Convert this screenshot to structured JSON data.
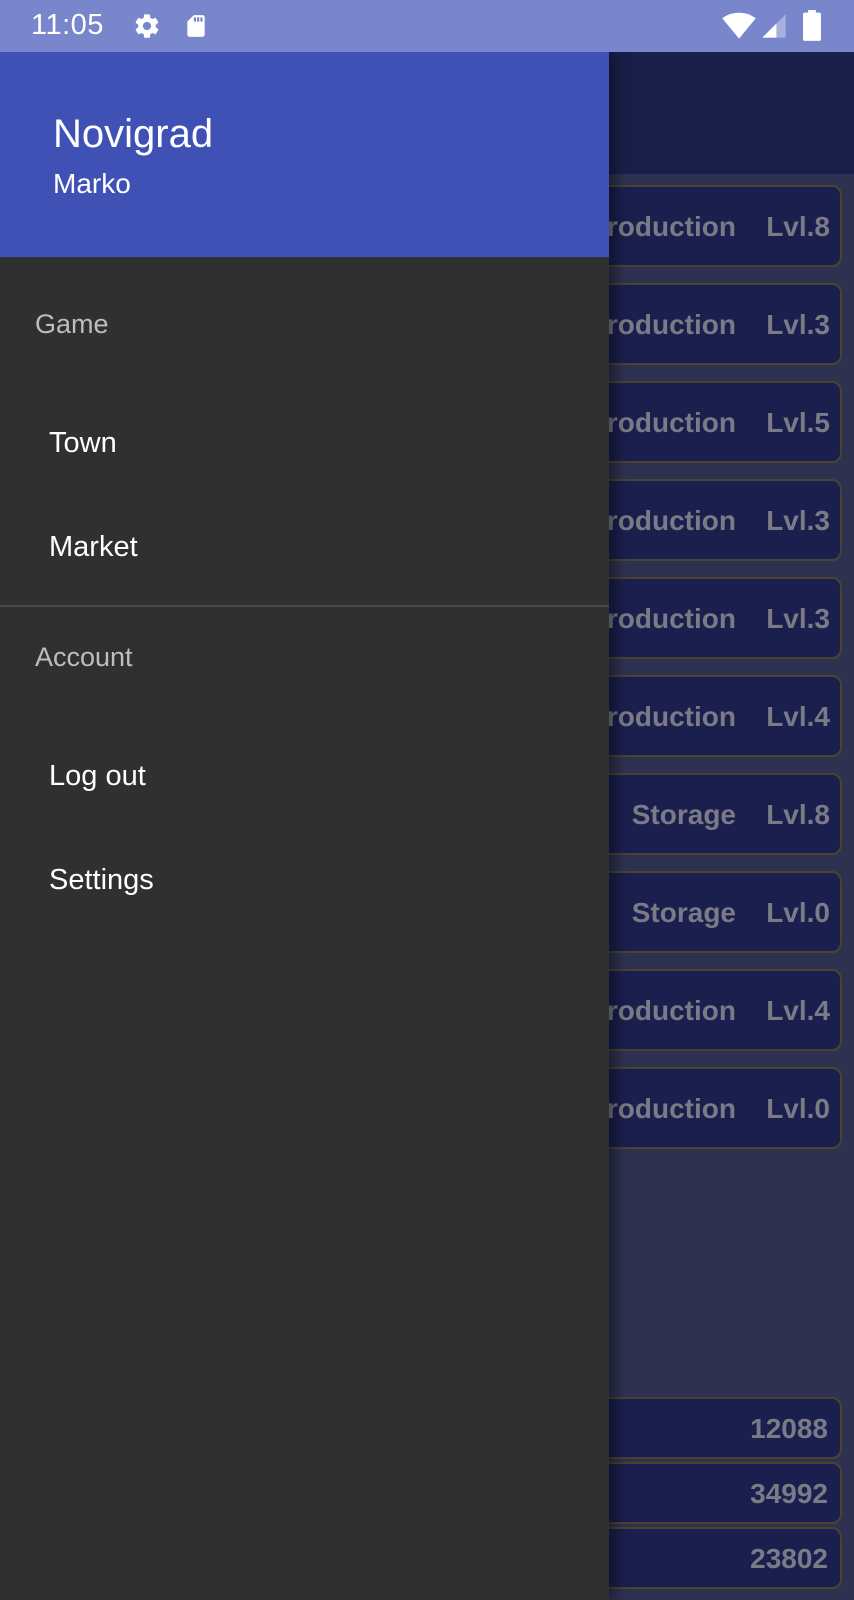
{
  "status_bar": {
    "time": "11:05",
    "icons": [
      "gear-icon",
      "sd-card-icon",
      "wifi-icon",
      "signal-icon",
      "battery-icon"
    ]
  },
  "drawer": {
    "title": "Novigrad",
    "subtitle": "Marko",
    "sections": [
      {
        "label": "Game",
        "items": [
          {
            "label": "Town"
          },
          {
            "label": "Market"
          }
        ]
      },
      {
        "label": "Account",
        "items": [
          {
            "label": "Log out"
          },
          {
            "label": "Settings"
          }
        ]
      }
    ]
  },
  "background": {
    "buildings": [
      {
        "type": "roduction",
        "level": "Lvl.8"
      },
      {
        "type": "roduction",
        "level": "Lvl.3"
      },
      {
        "type": "roduction",
        "level": "Lvl.5"
      },
      {
        "type": "roduction",
        "level": "Lvl.3"
      },
      {
        "type": "roduction",
        "level": "Lvl.3"
      },
      {
        "type": "roduction",
        "level": "Lvl.4"
      },
      {
        "type": "Storage",
        "level": "Lvl.8"
      },
      {
        "type": "Storage",
        "level": "Lvl.0"
      },
      {
        "type": "roduction",
        "level": "Lvl.4"
      },
      {
        "type": "roduction",
        "level": "Lvl.0"
      }
    ],
    "resources": [
      {
        "value": "12088"
      },
      {
        "value": "34992"
      },
      {
        "value": "23802"
      }
    ]
  },
  "colors": {
    "status_bar": "#7986cb",
    "drawer_header": "#3f51b5",
    "drawer_body": "#303030",
    "app_background": "#2e3150",
    "card_background": "#1a1f4e",
    "card_border": "#4a4330"
  }
}
